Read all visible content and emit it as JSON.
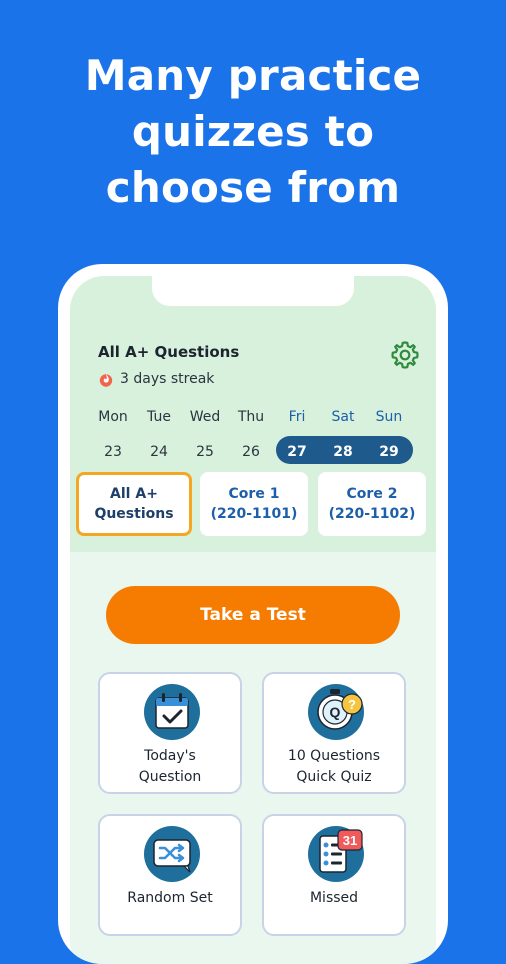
{
  "headline": [
    "Many practice",
    "quizzes to",
    "choose from"
  ],
  "header": {
    "title": "All A+ Questions",
    "streak": "3 days streak"
  },
  "week": {
    "days": [
      {
        "name": "Mon",
        "num": "23",
        "highlight": false
      },
      {
        "name": "Tue",
        "num": "24",
        "highlight": false
      },
      {
        "name": "Wed",
        "num": "25",
        "highlight": false
      },
      {
        "name": "Thu",
        "num": "26",
        "highlight": false
      },
      {
        "name": "Fri",
        "num": "27",
        "highlight": true
      },
      {
        "name": "Sat",
        "num": "28",
        "highlight": true
      },
      {
        "name": "Sun",
        "num": "29",
        "highlight": true
      }
    ]
  },
  "filters": [
    {
      "line1": "All A+",
      "line2": "Questions",
      "active": true
    },
    {
      "line1": "Core 1",
      "line2": "(220-1101)",
      "active": false
    },
    {
      "line1": "Core 2",
      "line2": "(220-1102)",
      "active": false
    }
  ],
  "cta": {
    "label": "Take a Test"
  },
  "cards": [
    {
      "line1": "Today's",
      "line2": "Question",
      "icon": "calendar-check-icon"
    },
    {
      "line1": "10 Questions",
      "line2": "Quick Quiz",
      "icon": "stopwatch-quiz-icon"
    },
    {
      "line1": "Random Set",
      "line2": "",
      "icon": "shuffle-icon"
    },
    {
      "line1": "Missed",
      "line2": "",
      "icon": "missed-list-icon"
    }
  ],
  "badge": {
    "count": "31"
  },
  "colors": {
    "background": "#1a73e8",
    "accent_orange": "#f57c00",
    "highlight_border": "#f5a623",
    "week_pill": "#1e5a8c",
    "panel_green": "#d8f1dc"
  }
}
